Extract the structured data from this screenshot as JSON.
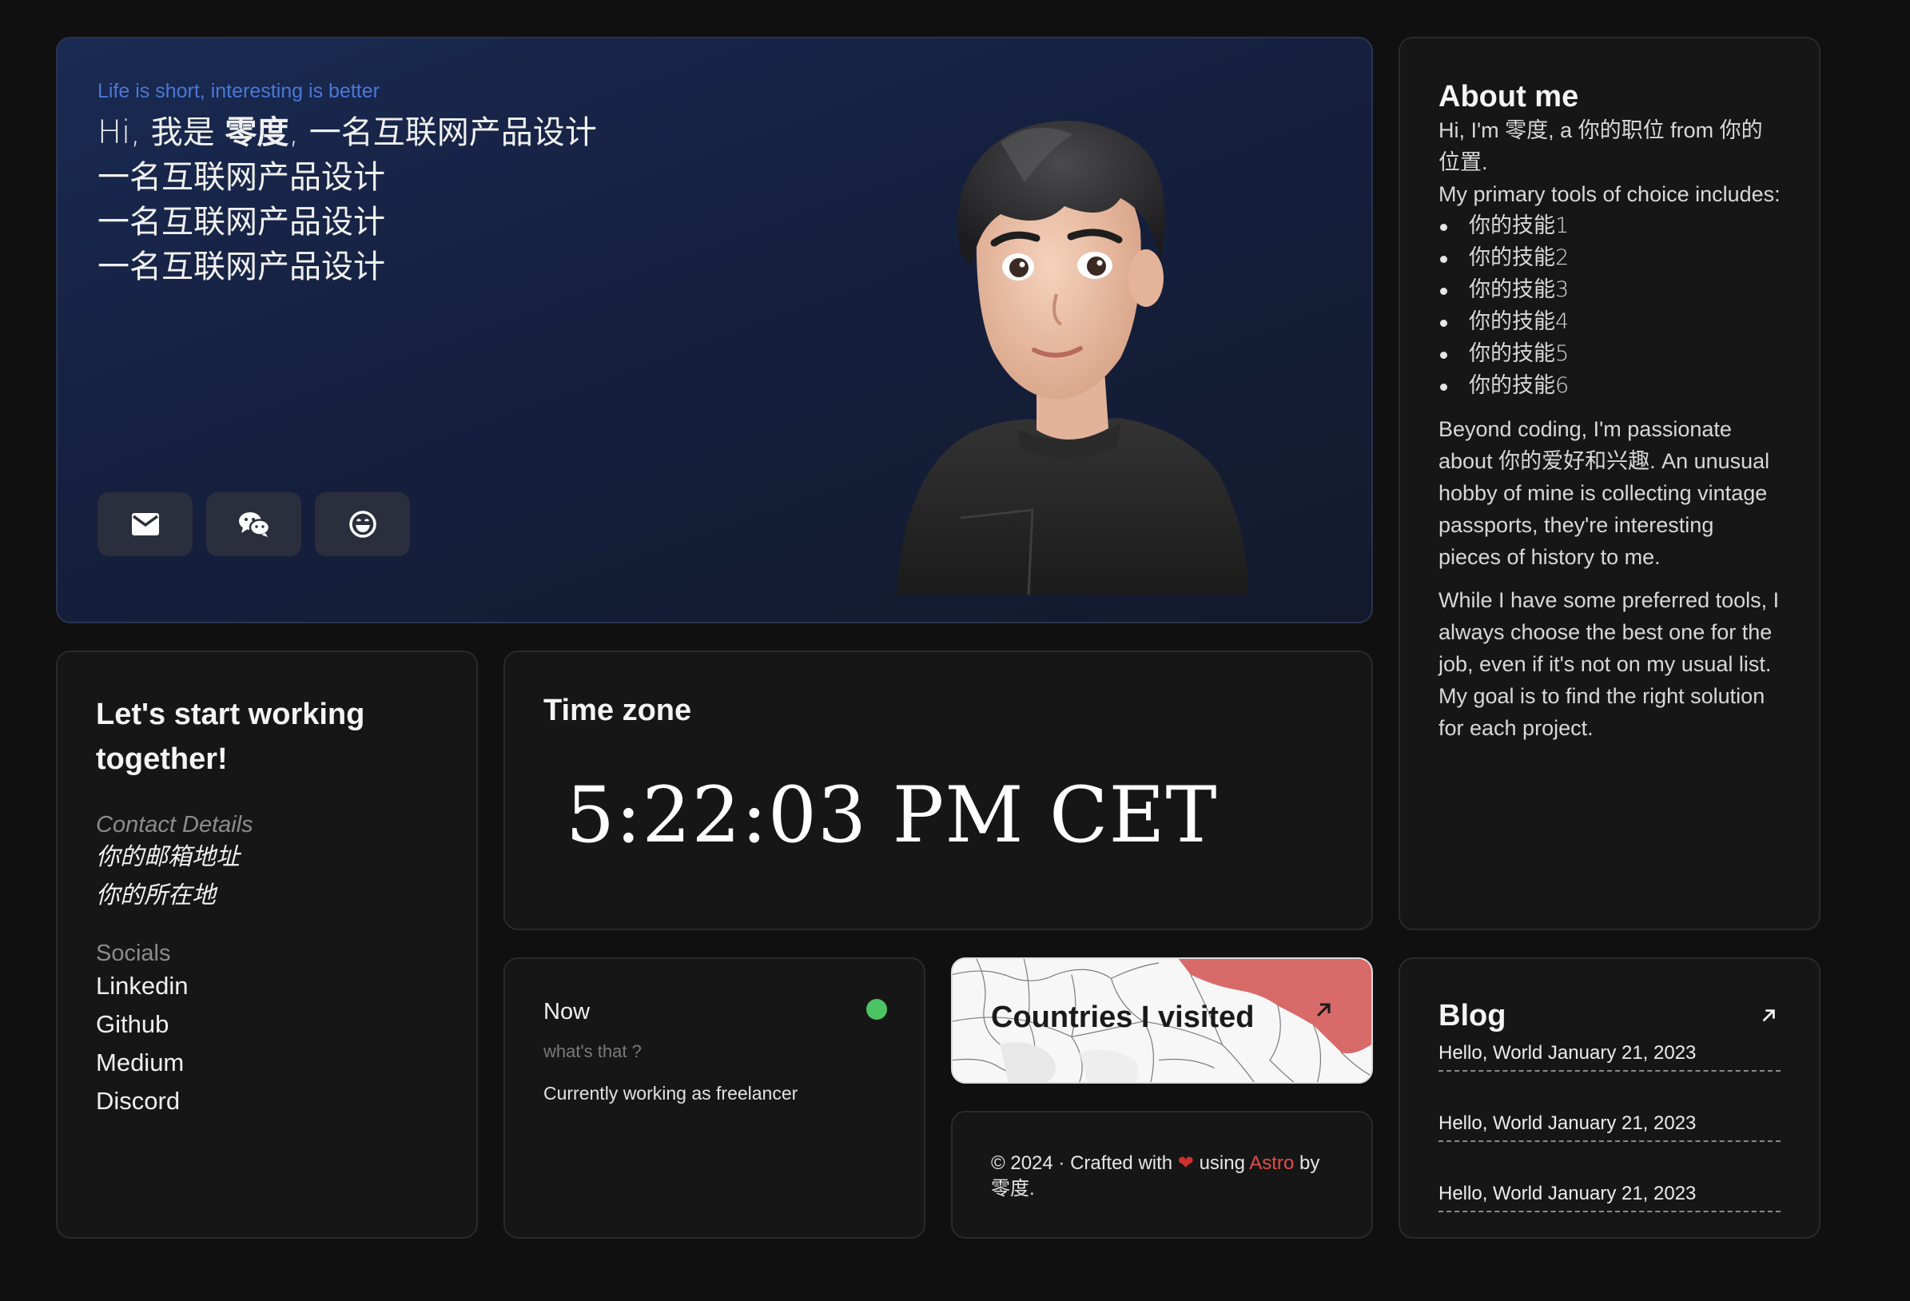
{
  "hero": {
    "tagline": "Life is short, interesting is better",
    "intro_prefix": "Hi, 我是 ",
    "name": "零度",
    "intro_suffix": ", 一名互联网产品设计",
    "lines": [
      "一名互联网产品设计",
      "一名互联网产品设计",
      "一名互联网产品设计"
    ],
    "buttons": [
      {
        "icon": "mail-icon"
      },
      {
        "icon": "wechat-icon"
      },
      {
        "icon": "smile-icon"
      }
    ]
  },
  "about": {
    "title": "About me",
    "intro": "Hi, I'm 零度, a 你的职位 from 你的位置.",
    "tools_intro": "My primary tools of choice includes:",
    "skills": [
      "你的技能1",
      "你的技能2",
      "你的技能3",
      "你的技能4",
      "你的技能5",
      "你的技能6"
    ],
    "paragraph1": "Beyond coding, I'm passionate about 你的爱好和兴趣. An unusual hobby of mine is collecting vintage passports, they're interesting pieces of history to me.",
    "paragraph2": "While I have some preferred tools, I always choose the best one for the job, even if it's not on my usual list. My goal is to find the right solution for each project."
  },
  "contact": {
    "title": "Let's start working together!",
    "details_label": "Contact Details",
    "email": "你的邮箱地址",
    "location": "你的所在地",
    "socials_label": "Socials",
    "socials": [
      "Linkedin",
      "Github",
      "Medium",
      "Discord"
    ]
  },
  "timezone": {
    "title": "Time zone",
    "time": "5:22:03 PM CET"
  },
  "now": {
    "title": "Now",
    "subtitle": "what's that ?",
    "status": "Currently working as freelancer",
    "status_color": "#4cc463"
  },
  "countries": {
    "label": "Countries I visited",
    "highlight_color": "#d96a6a"
  },
  "footer": {
    "prefix": "© 2024 · Crafted with ",
    "heart": "❤",
    "middle": " using ",
    "framework": "Astro",
    "suffix": " by 零度."
  },
  "blog": {
    "title": "Blog",
    "posts": [
      "Hello, World January 21, 2023",
      "Hello, World January 21, 2023",
      "Hello, World January 21, 2023"
    ]
  }
}
